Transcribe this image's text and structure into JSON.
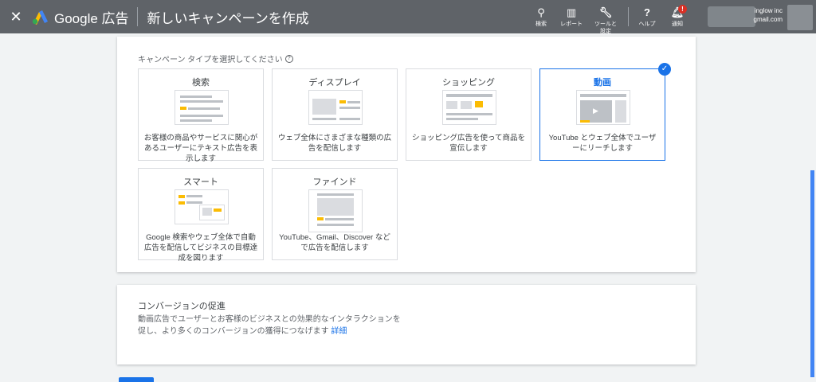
{
  "header": {
    "brand": "Google 広告",
    "title": "新しいキャンペーンを作成",
    "tools": [
      {
        "label": "検索",
        "icon": "search-icon"
      },
      {
        "label": "レポート",
        "icon": "reports-icon"
      },
      {
        "label": "ツールと設定",
        "icon": "wrench-icon"
      },
      {
        "label": "ヘルプ",
        "icon": "help-icon"
      },
      {
        "label": "通知",
        "icon": "bell-icon",
        "badge": "!"
      }
    ],
    "account": {
      "name": "inglow inc",
      "email": "gmail.com"
    }
  },
  "campaign_types": {
    "prompt": "キャンペーン タイプを選択してください",
    "tiles": [
      {
        "title": "検索",
        "desc": "お客様の商品やサービスに関心があるユーザーにテキスト広告を表示します",
        "selected": false
      },
      {
        "title": "ディスプレイ",
        "desc": "ウェブ全体にさまざまな種類の広告を配信します",
        "selected": false
      },
      {
        "title": "ショッピング",
        "desc": "ショッピング広告を使って商品を宣伝します",
        "selected": false
      },
      {
        "title": "動画",
        "desc": "YouTube とウェブ全体でユーザーにリーチします",
        "selected": true
      },
      {
        "title": "スマート",
        "desc": "Google 検索やウェブ全体で自動広告を配信してビジネスの目標達成を図ります",
        "selected": false
      },
      {
        "title": "ファインド",
        "desc": "YouTube、Gmail、Discover などで広告を配信します",
        "selected": false
      }
    ]
  },
  "conversion": {
    "title": "コンバージョンの促進",
    "body": "動画広告でユーザーとお客様のビジネスとの効果的なインタラクションを促し、より多くのコンバージョンの獲得につなげます",
    "link": "詳細"
  },
  "colors": {
    "topbar": "#5f6368",
    "accent": "#1a73e8",
    "yellow": "#fbbc04"
  }
}
